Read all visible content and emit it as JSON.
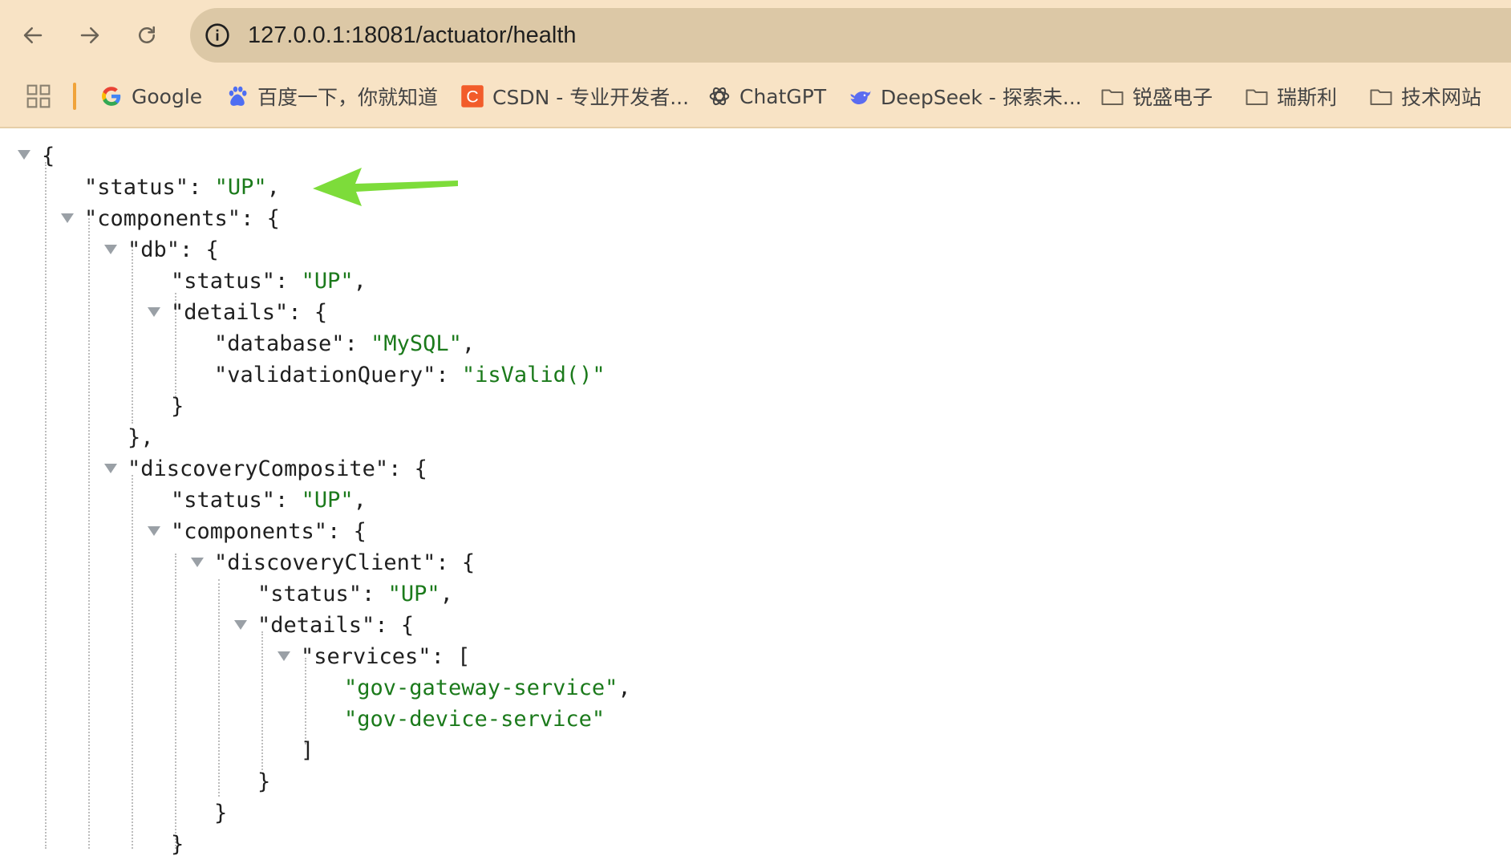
{
  "browser": {
    "url": "127.0.0.1:18081/actuator/health",
    "bookmarks": [
      {
        "label": "Google",
        "icon": "google-icon"
      },
      {
        "label": "百度一下，你就知道",
        "icon": "baidu-paw-icon"
      },
      {
        "label": "CSDN - 专业开发者...",
        "icon": "csdn-icon"
      },
      {
        "label": "ChatGPT",
        "icon": "openai-icon"
      },
      {
        "label": "DeepSeek - 探索未...",
        "icon": "deepseek-whale-icon"
      },
      {
        "label": "锐盛电子",
        "icon": "folder-icon"
      },
      {
        "label": "瑞斯利",
        "icon": "folder-icon"
      },
      {
        "label": "技术网站",
        "icon": "folder-icon"
      }
    ]
  },
  "colors": {
    "toolbar": "#f8e3c5",
    "omnibox": "#dcc8a6",
    "string": "#1b7a1b",
    "arrow": "#7ddc3a"
  },
  "json": {
    "l0": "{",
    "l1_key": "\"status\"",
    "l1_val": "\"UP\"",
    "l2_key": "\"components\"",
    "l2_open": "{",
    "l3_key": "\"db\"",
    "l3_open": "{",
    "l4_key": "\"status\"",
    "l4_val": "\"UP\"",
    "l5_key": "\"details\"",
    "l5_open": "{",
    "l6_key": "\"database\"",
    "l6_val": "\"MySQL\"",
    "l7_key": "\"validationQuery\"",
    "l7_val": "\"isValid()\"",
    "l8": "}",
    "l9": "},",
    "l10_key": "\"discoveryComposite\"",
    "l10_open": "{",
    "l11_key": "\"status\"",
    "l11_val": "\"UP\"",
    "l12_key": "\"components\"",
    "l12_open": "{",
    "l13_key": "\"discoveryClient\"",
    "l13_open": "{",
    "l14_key": "\"status\"",
    "l14_val": "\"UP\"",
    "l15_key": "\"details\"",
    "l15_open": "{",
    "l16_key": "\"services\"",
    "l16_open": "[",
    "l17_val": "\"gov-gateway-service\"",
    "l18_val": "\"gov-device-service\"",
    "l19": "]",
    "l20": "}",
    "l21": "}",
    "l22": "}"
  }
}
